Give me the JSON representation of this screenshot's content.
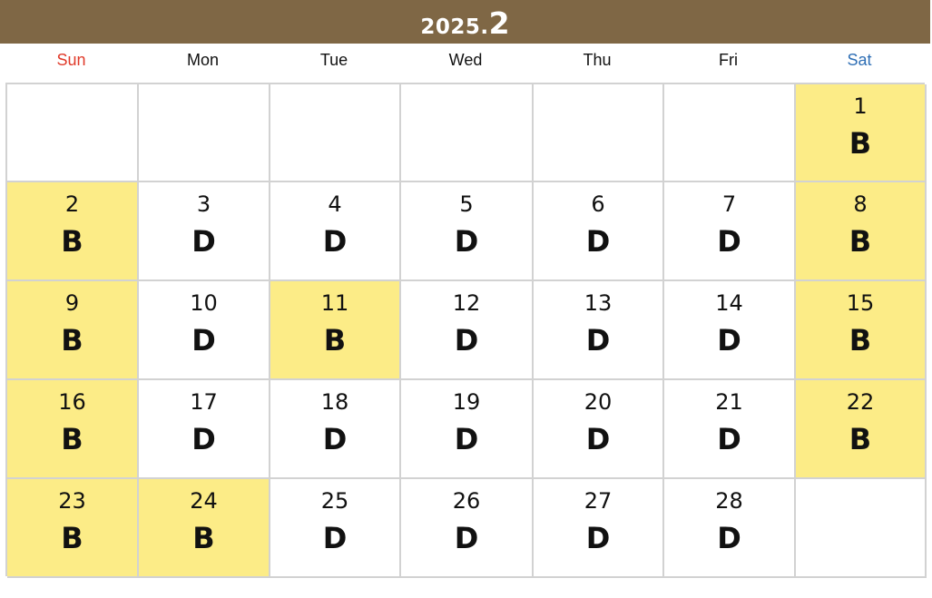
{
  "header": {
    "year": "2025",
    "separator": ".",
    "month": "2"
  },
  "colors": {
    "header_bg": "#7f6745",
    "highlight": "#fcec87",
    "sunday": "#e03a2a",
    "saturday": "#2f6fb5"
  },
  "weekdays": [
    "Sun",
    "Mon",
    "Tue",
    "Wed",
    "Thu",
    "Fri",
    "Sat"
  ],
  "weeks": [
    [
      null,
      null,
      null,
      null,
      null,
      null,
      {
        "day": "1",
        "mark": "B",
        "highlight": true
      }
    ],
    [
      {
        "day": "2",
        "mark": "B",
        "highlight": true
      },
      {
        "day": "3",
        "mark": "D",
        "highlight": false
      },
      {
        "day": "4",
        "mark": "D",
        "highlight": false
      },
      {
        "day": "5",
        "mark": "D",
        "highlight": false
      },
      {
        "day": "6",
        "mark": "D",
        "highlight": false
      },
      {
        "day": "7",
        "mark": "D",
        "highlight": false
      },
      {
        "day": "8",
        "mark": "B",
        "highlight": true
      }
    ],
    [
      {
        "day": "9",
        "mark": "B",
        "highlight": true
      },
      {
        "day": "10",
        "mark": "D",
        "highlight": false
      },
      {
        "day": "11",
        "mark": "B",
        "highlight": true
      },
      {
        "day": "12",
        "mark": "D",
        "highlight": false
      },
      {
        "day": "13",
        "mark": "D",
        "highlight": false
      },
      {
        "day": "14",
        "mark": "D",
        "highlight": false
      },
      {
        "day": "15",
        "mark": "B",
        "highlight": true
      }
    ],
    [
      {
        "day": "16",
        "mark": "B",
        "highlight": true
      },
      {
        "day": "17",
        "mark": "D",
        "highlight": false
      },
      {
        "day": "18",
        "mark": "D",
        "highlight": false
      },
      {
        "day": "19",
        "mark": "D",
        "highlight": false
      },
      {
        "day": "20",
        "mark": "D",
        "highlight": false
      },
      {
        "day": "21",
        "mark": "D",
        "highlight": false
      },
      {
        "day": "22",
        "mark": "B",
        "highlight": true
      }
    ],
    [
      {
        "day": "23",
        "mark": "B",
        "highlight": true
      },
      {
        "day": "24",
        "mark": "B",
        "highlight": true
      },
      {
        "day": "25",
        "mark": "D",
        "highlight": false
      },
      {
        "day": "26",
        "mark": "D",
        "highlight": false
      },
      {
        "day": "27",
        "mark": "D",
        "highlight": false
      },
      {
        "day": "28",
        "mark": "D",
        "highlight": false
      },
      null
    ]
  ]
}
